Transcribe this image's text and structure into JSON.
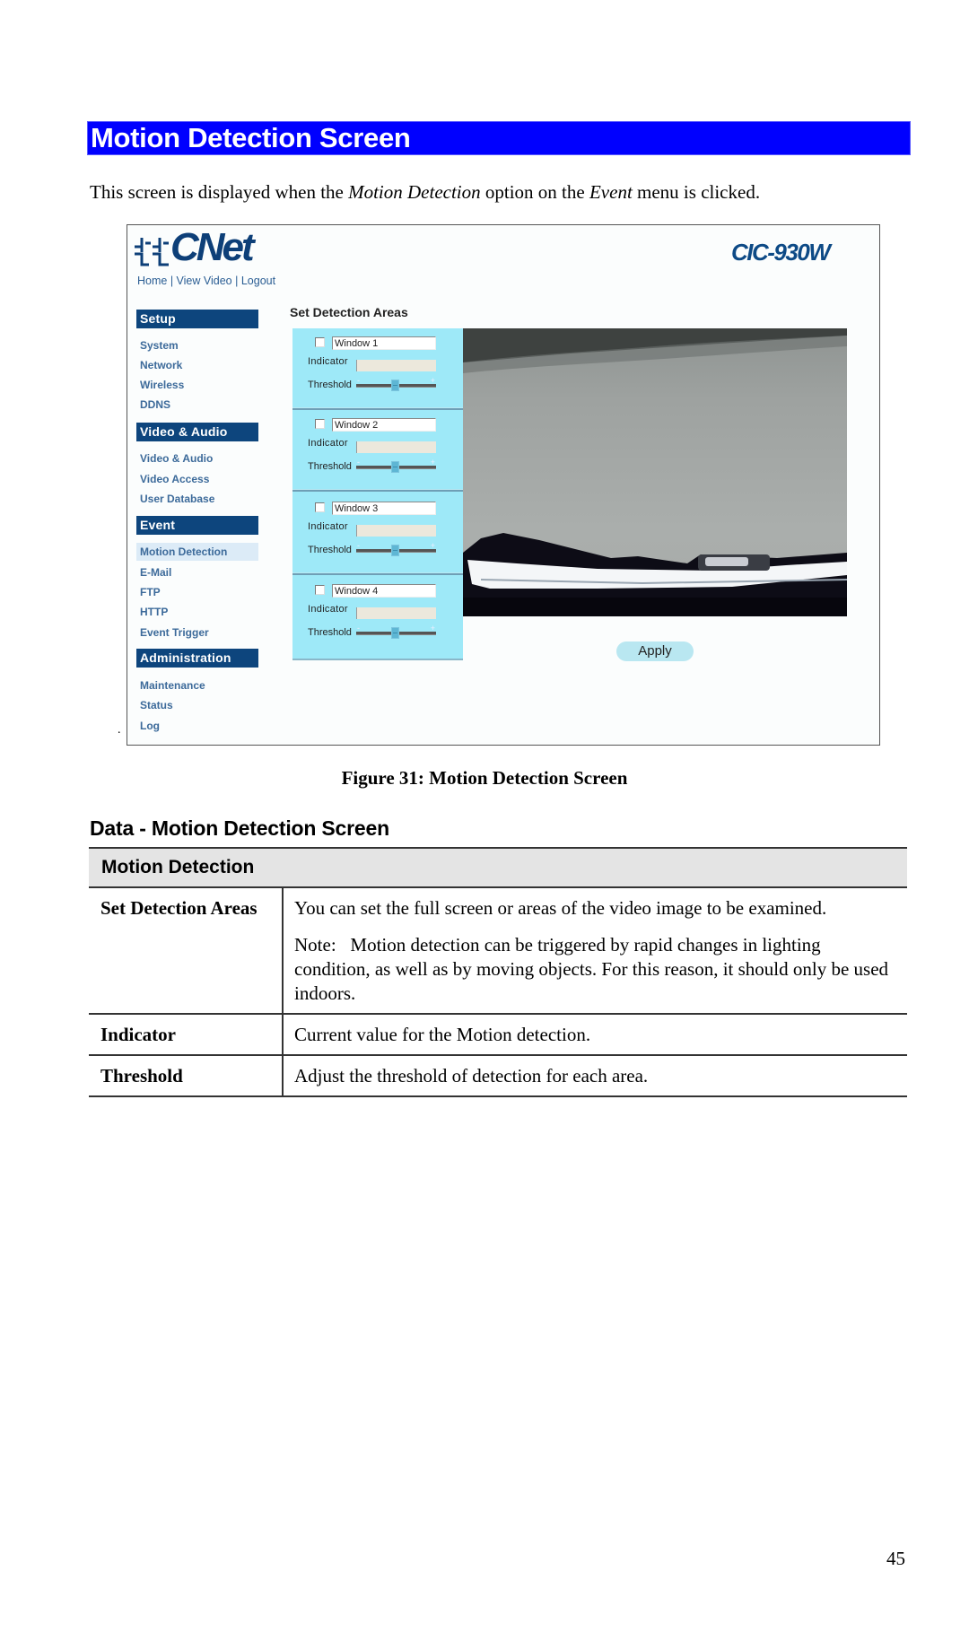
{
  "section": {
    "heading": "Motion Detection Screen",
    "intro_parts": [
      "This screen is displayed when the ",
      "Motion Detection",
      " option on the ",
      "Event",
      " menu is clicked."
    ]
  },
  "screenshot": {
    "brand": "CNet",
    "model": "CIC-930W",
    "top_links": [
      "Home",
      "View Video",
      "Logout"
    ],
    "top_links_separator": " | ",
    "sidebar": [
      {
        "heading": "Setup",
        "items": [
          "System",
          "Network",
          "Wireless",
          "DDNS"
        ]
      },
      {
        "heading": "Video & Audio",
        "items": [
          "Video & Audio",
          "Video Access",
          "User Database"
        ]
      },
      {
        "heading": "Event",
        "items": [
          "Motion Detection",
          "E-Mail",
          "FTP",
          "HTTP",
          "Event Trigger"
        ]
      },
      {
        "heading": "Administration",
        "items": [
          "Maintenance",
          "Status",
          "Log"
        ]
      }
    ],
    "active_item": "Motion Detection",
    "detection_title": "Set Detection Areas",
    "windows": [
      {
        "name": "Window 1",
        "enabled": false,
        "indicator_label": "Indicator",
        "threshold_label": "Threshold",
        "threshold_percent": 48
      },
      {
        "name": "Window 2",
        "enabled": false,
        "indicator_label": "Indicator",
        "threshold_label": "Threshold",
        "threshold_percent": 48
      },
      {
        "name": "Window 3",
        "enabled": false,
        "indicator_label": "Indicator",
        "threshold_label": "Threshold",
        "threshold_percent": 48
      },
      {
        "name": "Window 4",
        "enabled": false,
        "indicator_label": "Indicator",
        "threshold_label": "Threshold",
        "threshold_percent": 48
      }
    ],
    "slider_min_symbol": "-",
    "slider_max_symbol": "+",
    "apply_label": "Apply",
    "colors": {
      "nav_heading": "#0d457d",
      "panel": "#9ee9f8",
      "active_item_bg": "#dcebf7"
    }
  },
  "stray_mark": ".",
  "caption": "Figure 31: Motion Detection Screen",
  "data_section": {
    "heading": "Data - Motion Detection Screen",
    "table_header": "Motion Detection",
    "rows": [
      {
        "term": "Set Detection Areas",
        "desc": [
          "You can set the full screen or areas of the video image to be examined.",
          "Note:   Motion detection can be triggered by rapid changes in lighting condition, as well as by moving objects. For this reason, it should only be used indoors."
        ]
      },
      {
        "term": "Indicator",
        "desc": [
          "Current value for the Motion detection."
        ]
      },
      {
        "term": "Threshold",
        "desc": [
          "Adjust the threshold of detection for each area."
        ]
      }
    ]
  },
  "page_number": "45",
  "heading_color": "#0000ff"
}
